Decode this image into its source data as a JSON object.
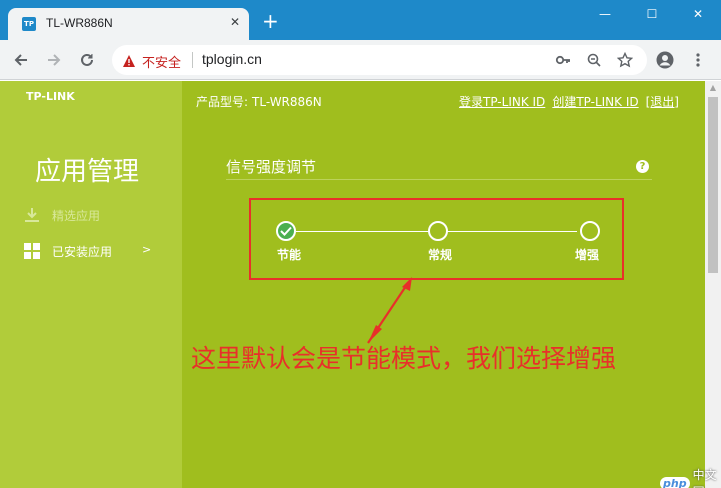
{
  "browser": {
    "tab": {
      "favicon": "TP",
      "title": "TL-WR886N",
      "close": "✕"
    },
    "new_tab": "+",
    "window": {
      "minimize": "—",
      "maximize": "☐",
      "close": "✕"
    },
    "address": {
      "security_label": "不安全",
      "url": "tplogin.cn"
    }
  },
  "page": {
    "logo": "TP-LINK",
    "sidebar": {
      "title": "应用管理",
      "items": [
        {
          "label": "精选应用",
          "state": "disabled"
        },
        {
          "label": "已安装应用",
          "state": "active",
          "chevron": ">"
        }
      ]
    },
    "header": {
      "model_label": "产品型号:",
      "model_value": "TL-WR886N",
      "links": [
        "登录TP-LINK ID",
        "创建TP-LINK ID",
        "[退出]"
      ]
    },
    "section": {
      "title": "信号强度调节",
      "help": "?",
      "levels": [
        {
          "label": "节能",
          "selected": true
        },
        {
          "label": "常规",
          "selected": false
        },
        {
          "label": "增强",
          "selected": false
        }
      ]
    },
    "annotation": "这里默认会是节能模式，我们选择增强"
  },
  "watermark": {
    "logo": "php",
    "text": "中文网"
  },
  "colors": {
    "titlebar": "#1e89c9",
    "page_bg": "#a0be1e",
    "sidebar_bg": "#b1cc3a",
    "annotation_red": "#e8302a",
    "selected_node": "#4caf50"
  }
}
